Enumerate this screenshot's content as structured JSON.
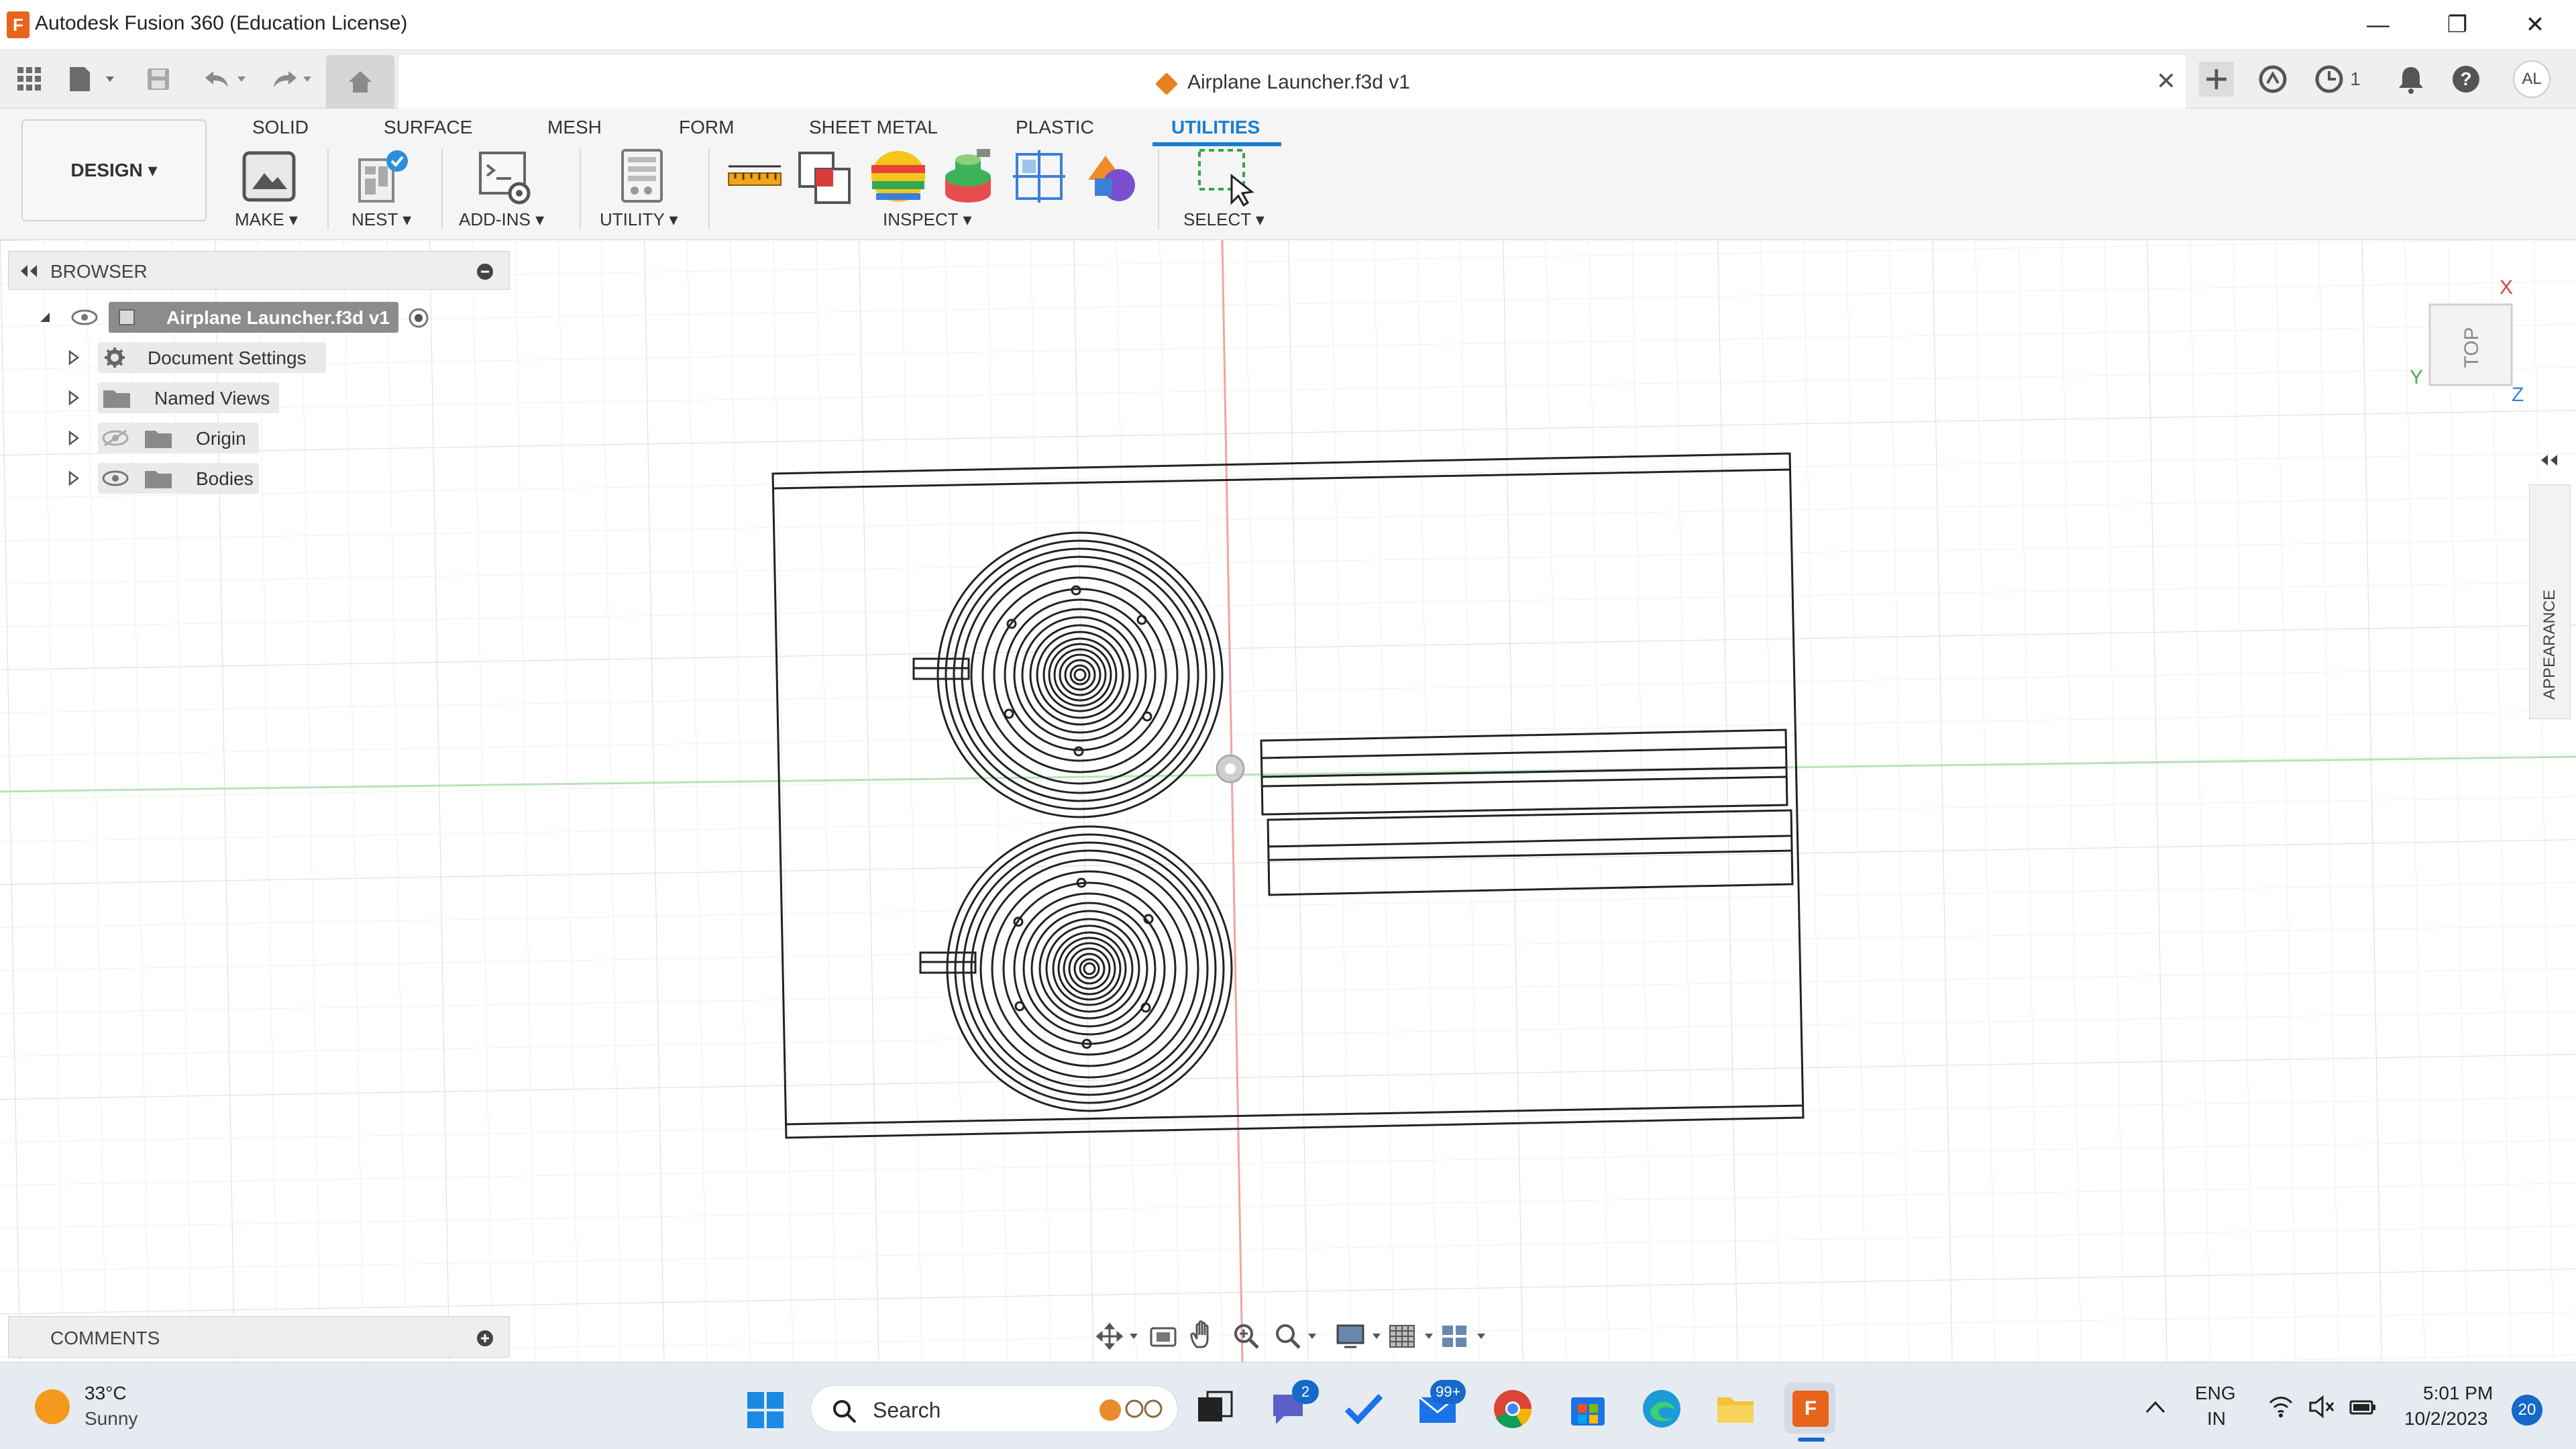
{
  "window": {
    "title": "Autodesk Fusion 360 (Education License)",
    "logo_letter": "F",
    "minimize": "—",
    "restore": "❐",
    "close": "✕"
  },
  "doc_tab": {
    "title": "Airplane Launcher.f3d v1",
    "close": "✕",
    "jobs_count": "1",
    "avatar": "AL"
  },
  "ribbon": {
    "workspace": "DESIGN ▾",
    "tabs": [
      "SOLID",
      "SURFACE",
      "MESH",
      "FORM",
      "SHEET METAL",
      "PLASTIC",
      "UTILITIES"
    ],
    "active_tab": "UTILITIES",
    "groups": [
      "MAKE ▾",
      "NEST ▾",
      "ADD-INS ▾",
      "UTILITY ▾",
      "INSPECT ▾",
      "SELECT ▾"
    ]
  },
  "browser": {
    "title": "BROWSER",
    "root": "Airplane Launcher.f3d v1",
    "items": [
      "Document Settings",
      "Named Views",
      "Origin",
      "Bodies"
    ]
  },
  "comments": {
    "title": "COMMENTS"
  },
  "viewcube": {
    "face": "TOP",
    "axis_x": "X",
    "axis_y": "Y",
    "axis_z": "Z"
  },
  "appearance": {
    "label": "APPEARANCE"
  },
  "taskbar": {
    "weather_temp": "33°C",
    "weather_desc": "Sunny",
    "search": "Search",
    "teams_badge": "2",
    "mail_badge": "99+",
    "lang_1": "ENG",
    "lang_2": "IN",
    "time": "5:01 PM",
    "date": "10/2/2023",
    "notifications": "20"
  },
  "colors": {
    "accent": "#1a7fd1",
    "fusion_orange": "#e8641b",
    "axis_red": "#e57373",
    "axis_green": "#81c784"
  }
}
